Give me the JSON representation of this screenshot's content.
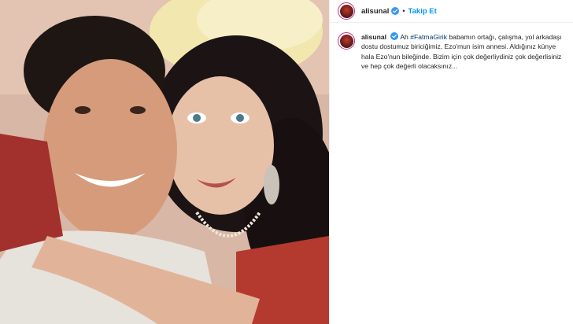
{
  "post": {
    "username": "alisunal",
    "follow_label": "Takip Et",
    "separator": "•",
    "caption_prefix": "Ah",
    "hashtag": "#FatmaGirik",
    "caption_text": "babamın ortağı, çalışma, yol arkadaşı dostu dostumuz biriciğimiz, Ezo'mun isim annesi. Aldığınız künye hala Ezo'nun bileğinde. Bizim için çok değerliydiniz çok değerlisiniz ve hep çok değerli olacaksınız..."
  },
  "colors": {
    "link_blue": "#0095f6",
    "hashtag": "#00376b",
    "verified_blue": "#3897f0",
    "story_ring": "#c13584"
  },
  "icons": [
    "verified-badge-icon",
    "avatar"
  ]
}
